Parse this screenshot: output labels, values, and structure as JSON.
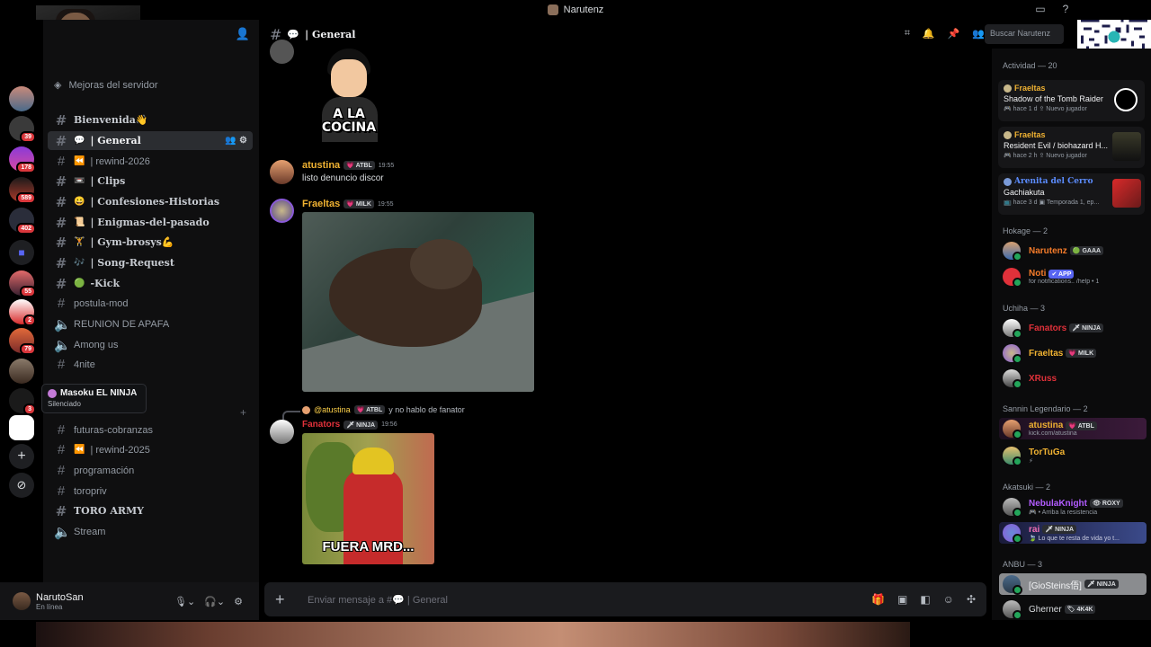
{
  "window": {
    "title": "Narutenz"
  },
  "servers": [
    {
      "badge": ""
    },
    {
      "badge": "39"
    },
    {
      "badge": "178"
    },
    {
      "badge": "589"
    },
    {
      "badge": "402"
    },
    {
      "badge": ""
    },
    {
      "badge": "55"
    },
    {
      "badge": "2"
    },
    {
      "badge": "79"
    },
    {
      "badge": ""
    },
    {
      "badge": "3"
    },
    {
      "badge": ""
    }
  ],
  "sidebar": {
    "boost": "Mejoras del servidor",
    "channels": [
      {
        "emoji": "",
        "label": "Bienvenida👋"
      },
      {
        "emoji": "💬",
        "label": "| General"
      },
      {
        "emoji": "⏪",
        "label": "| rewind-2026"
      },
      {
        "emoji": "📼",
        "label": "| Clips"
      },
      {
        "emoji": "😀",
        "label": "| Confesiones-Historias"
      },
      {
        "emoji": "📜",
        "label": "| Enigmas-del-pasado"
      },
      {
        "emoji": "🏋",
        "label": "| Gym-brosys💪"
      },
      {
        "emoji": "🎶",
        "label": "| Song-Request"
      },
      {
        "emoji": "🟢",
        "label": "-Kick"
      },
      {
        "emoji": "",
        "label": "postula-mod"
      },
      {
        "emoji": "",
        "label": "REUNION DE APAFA"
      },
      {
        "emoji": "",
        "label": "Among us"
      },
      {
        "emoji": "",
        "label": "4nite"
      },
      {
        "emoji": "",
        "label": "futuras-cobranzas"
      },
      {
        "emoji": "⏪",
        "label": "| rewind-2025"
      },
      {
        "emoji": "",
        "label": "programación"
      },
      {
        "emoji": "",
        "label": "toropriv"
      },
      {
        "emoji": "",
        "label": "TORO ARMY"
      },
      {
        "emoji": "",
        "label": "Stream"
      }
    ],
    "tooltip": {
      "name": "Masoku EL NINJA",
      "status": "Silenciado"
    }
  },
  "user": {
    "name": "NarutoSan",
    "status": "En línea"
  },
  "chat": {
    "channel_emoji": "💬",
    "channel_name": "| General",
    "search_placeholder": "Buscar Narutenz",
    "sticker_text": "A LA COCINA",
    "messages": [
      {
        "author": "atustina",
        "tag": "💗 ATBL",
        "time": "19:55",
        "text": "listo denuncio discor"
      },
      {
        "author": "Fraeltas",
        "tag": "💗 MILK",
        "time": "19:55"
      },
      {
        "author": "Fanators",
        "tag": "🗡 NINJA",
        "time": "19:56"
      }
    ],
    "reply": {
      "name": "@atustina",
      "tag": "💗 ATBL",
      "text": "y no hablo de fanator"
    },
    "gif_caption": "FUERA MRD...",
    "composer_placeholder": "Enviar mensaje a #💬 | General"
  },
  "members": {
    "activity_header": "Actividad — 20",
    "activities": [
      {
        "user": "Fraeltas",
        "game": "Shadow of the Tomb Raider",
        "detail": "🎮 hace 1 d  ⇪ Nuevo jugador"
      },
      {
        "user": "Fraeltas",
        "game": "Resident Evil / biohazard H...",
        "detail": "🎮 hace 2 h  ⇪ Nuevo jugador"
      },
      {
        "user": "Arenita del Cerro",
        "game": "Gachiakuta",
        "detail": "📺 hace 3 d  ▣ Temporada 1, ep..."
      }
    ],
    "sections": [
      {
        "title": "Hokage — 2",
        "items": [
          {
            "name": "Narutenz",
            "tag": "🟢 GAAA",
            "status": ""
          },
          {
            "name": "Noti",
            "tag": "✔ APP",
            "status": "for notifications.. /help • 1"
          }
        ]
      },
      {
        "title": "Uchiha — 3",
        "items": [
          {
            "name": "Fanators",
            "tag": "🗡 NINJA",
            "status": ""
          },
          {
            "name": "Fraeltas",
            "tag": "💗 MILK",
            "status": ""
          },
          {
            "name": "XRuss",
            "tag": "",
            "status": ""
          }
        ]
      },
      {
        "title": "Sannin Legendario — 2",
        "items": [
          {
            "name": "atustina",
            "tag": "💗 ATBL",
            "status": "kick.com/atustina"
          },
          {
            "name": "TorTuGa",
            "tag": "",
            "status": "⚡"
          }
        ]
      },
      {
        "title": "Akatsuki — 2",
        "items": [
          {
            "name": "NebulaKnight",
            "tag": "👁 ROXY",
            "status": "🎮 • Arriba la resistencia"
          },
          {
            "name": "rai",
            "tag": "🗡 NINJA",
            "status": "🍃 Lo que te resta de vida yo t..."
          }
        ]
      },
      {
        "title": "ANBU — 3",
        "items": [
          {
            "name": "[GioSteins俉]",
            "tag": "🗡 NINJA",
            "status": ""
          },
          {
            "name": "Gherner",
            "tag": "🏷 4K4K",
            "status": ""
          }
        ]
      }
    ]
  },
  "colors": {
    "gold": "#f0b232",
    "red": "#e0313a",
    "orange": "#f47b2a",
    "pink": "#f26fb5",
    "blue": "#5b8cff",
    "purple": "#b25cff"
  }
}
